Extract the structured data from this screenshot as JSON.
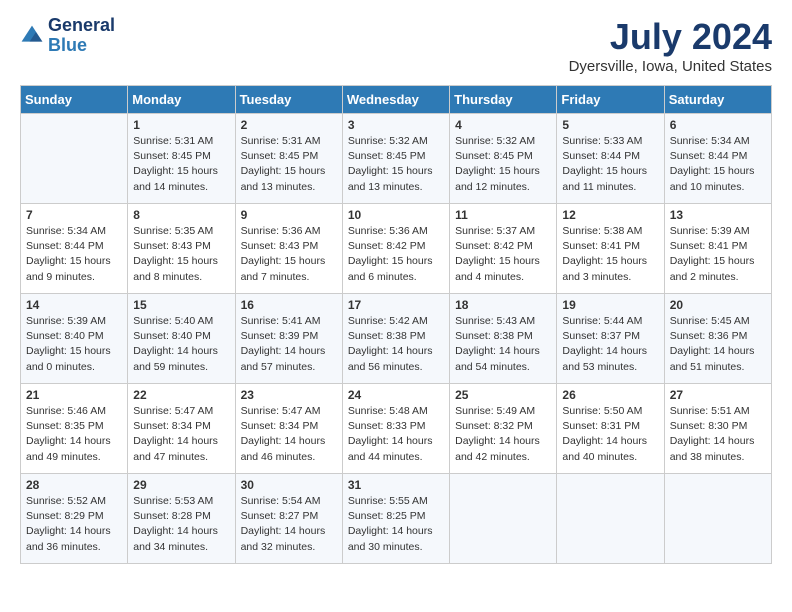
{
  "header": {
    "logo": {
      "general": "General",
      "blue": "Blue"
    },
    "title": "July 2024",
    "location": "Dyersville, Iowa, United States"
  },
  "weekdays": [
    "Sunday",
    "Monday",
    "Tuesday",
    "Wednesday",
    "Thursday",
    "Friday",
    "Saturday"
  ],
  "weeks": [
    [
      {
        "day": "",
        "sunrise": "",
        "sunset": "",
        "daylight": ""
      },
      {
        "day": "1",
        "sunrise": "Sunrise: 5:31 AM",
        "sunset": "Sunset: 8:45 PM",
        "daylight": "Daylight: 15 hours and 14 minutes."
      },
      {
        "day": "2",
        "sunrise": "Sunrise: 5:31 AM",
        "sunset": "Sunset: 8:45 PM",
        "daylight": "Daylight: 15 hours and 13 minutes."
      },
      {
        "day": "3",
        "sunrise": "Sunrise: 5:32 AM",
        "sunset": "Sunset: 8:45 PM",
        "daylight": "Daylight: 15 hours and 13 minutes."
      },
      {
        "day": "4",
        "sunrise": "Sunrise: 5:32 AM",
        "sunset": "Sunset: 8:45 PM",
        "daylight": "Daylight: 15 hours and 12 minutes."
      },
      {
        "day": "5",
        "sunrise": "Sunrise: 5:33 AM",
        "sunset": "Sunset: 8:44 PM",
        "daylight": "Daylight: 15 hours and 11 minutes."
      },
      {
        "day": "6",
        "sunrise": "Sunrise: 5:34 AM",
        "sunset": "Sunset: 8:44 PM",
        "daylight": "Daylight: 15 hours and 10 minutes."
      }
    ],
    [
      {
        "day": "7",
        "sunrise": "Sunrise: 5:34 AM",
        "sunset": "Sunset: 8:44 PM",
        "daylight": "Daylight: 15 hours and 9 minutes."
      },
      {
        "day": "8",
        "sunrise": "Sunrise: 5:35 AM",
        "sunset": "Sunset: 8:43 PM",
        "daylight": "Daylight: 15 hours and 8 minutes."
      },
      {
        "day": "9",
        "sunrise": "Sunrise: 5:36 AM",
        "sunset": "Sunset: 8:43 PM",
        "daylight": "Daylight: 15 hours and 7 minutes."
      },
      {
        "day": "10",
        "sunrise": "Sunrise: 5:36 AM",
        "sunset": "Sunset: 8:42 PM",
        "daylight": "Daylight: 15 hours and 6 minutes."
      },
      {
        "day": "11",
        "sunrise": "Sunrise: 5:37 AM",
        "sunset": "Sunset: 8:42 PM",
        "daylight": "Daylight: 15 hours and 4 minutes."
      },
      {
        "day": "12",
        "sunrise": "Sunrise: 5:38 AM",
        "sunset": "Sunset: 8:41 PM",
        "daylight": "Daylight: 15 hours and 3 minutes."
      },
      {
        "day": "13",
        "sunrise": "Sunrise: 5:39 AM",
        "sunset": "Sunset: 8:41 PM",
        "daylight": "Daylight: 15 hours and 2 minutes."
      }
    ],
    [
      {
        "day": "14",
        "sunrise": "Sunrise: 5:39 AM",
        "sunset": "Sunset: 8:40 PM",
        "daylight": "Daylight: 15 hours and 0 minutes."
      },
      {
        "day": "15",
        "sunrise": "Sunrise: 5:40 AM",
        "sunset": "Sunset: 8:40 PM",
        "daylight": "Daylight: 14 hours and 59 minutes."
      },
      {
        "day": "16",
        "sunrise": "Sunrise: 5:41 AM",
        "sunset": "Sunset: 8:39 PM",
        "daylight": "Daylight: 14 hours and 57 minutes."
      },
      {
        "day": "17",
        "sunrise": "Sunrise: 5:42 AM",
        "sunset": "Sunset: 8:38 PM",
        "daylight": "Daylight: 14 hours and 56 minutes."
      },
      {
        "day": "18",
        "sunrise": "Sunrise: 5:43 AM",
        "sunset": "Sunset: 8:38 PM",
        "daylight": "Daylight: 14 hours and 54 minutes."
      },
      {
        "day": "19",
        "sunrise": "Sunrise: 5:44 AM",
        "sunset": "Sunset: 8:37 PM",
        "daylight": "Daylight: 14 hours and 53 minutes."
      },
      {
        "day": "20",
        "sunrise": "Sunrise: 5:45 AM",
        "sunset": "Sunset: 8:36 PM",
        "daylight": "Daylight: 14 hours and 51 minutes."
      }
    ],
    [
      {
        "day": "21",
        "sunrise": "Sunrise: 5:46 AM",
        "sunset": "Sunset: 8:35 PM",
        "daylight": "Daylight: 14 hours and 49 minutes."
      },
      {
        "day": "22",
        "sunrise": "Sunrise: 5:47 AM",
        "sunset": "Sunset: 8:34 PM",
        "daylight": "Daylight: 14 hours and 47 minutes."
      },
      {
        "day": "23",
        "sunrise": "Sunrise: 5:47 AM",
        "sunset": "Sunset: 8:34 PM",
        "daylight": "Daylight: 14 hours and 46 minutes."
      },
      {
        "day": "24",
        "sunrise": "Sunrise: 5:48 AM",
        "sunset": "Sunset: 8:33 PM",
        "daylight": "Daylight: 14 hours and 44 minutes."
      },
      {
        "day": "25",
        "sunrise": "Sunrise: 5:49 AM",
        "sunset": "Sunset: 8:32 PM",
        "daylight": "Daylight: 14 hours and 42 minutes."
      },
      {
        "day": "26",
        "sunrise": "Sunrise: 5:50 AM",
        "sunset": "Sunset: 8:31 PM",
        "daylight": "Daylight: 14 hours and 40 minutes."
      },
      {
        "day": "27",
        "sunrise": "Sunrise: 5:51 AM",
        "sunset": "Sunset: 8:30 PM",
        "daylight": "Daylight: 14 hours and 38 minutes."
      }
    ],
    [
      {
        "day": "28",
        "sunrise": "Sunrise: 5:52 AM",
        "sunset": "Sunset: 8:29 PM",
        "daylight": "Daylight: 14 hours and 36 minutes."
      },
      {
        "day": "29",
        "sunrise": "Sunrise: 5:53 AM",
        "sunset": "Sunset: 8:28 PM",
        "daylight": "Daylight: 14 hours and 34 minutes."
      },
      {
        "day": "30",
        "sunrise": "Sunrise: 5:54 AM",
        "sunset": "Sunset: 8:27 PM",
        "daylight": "Daylight: 14 hours and 32 minutes."
      },
      {
        "day": "31",
        "sunrise": "Sunrise: 5:55 AM",
        "sunset": "Sunset: 8:25 PM",
        "daylight": "Daylight: 14 hours and 30 minutes."
      },
      {
        "day": "",
        "sunrise": "",
        "sunset": "",
        "daylight": ""
      },
      {
        "day": "",
        "sunrise": "",
        "sunset": "",
        "daylight": ""
      },
      {
        "day": "",
        "sunrise": "",
        "sunset": "",
        "daylight": ""
      }
    ]
  ]
}
